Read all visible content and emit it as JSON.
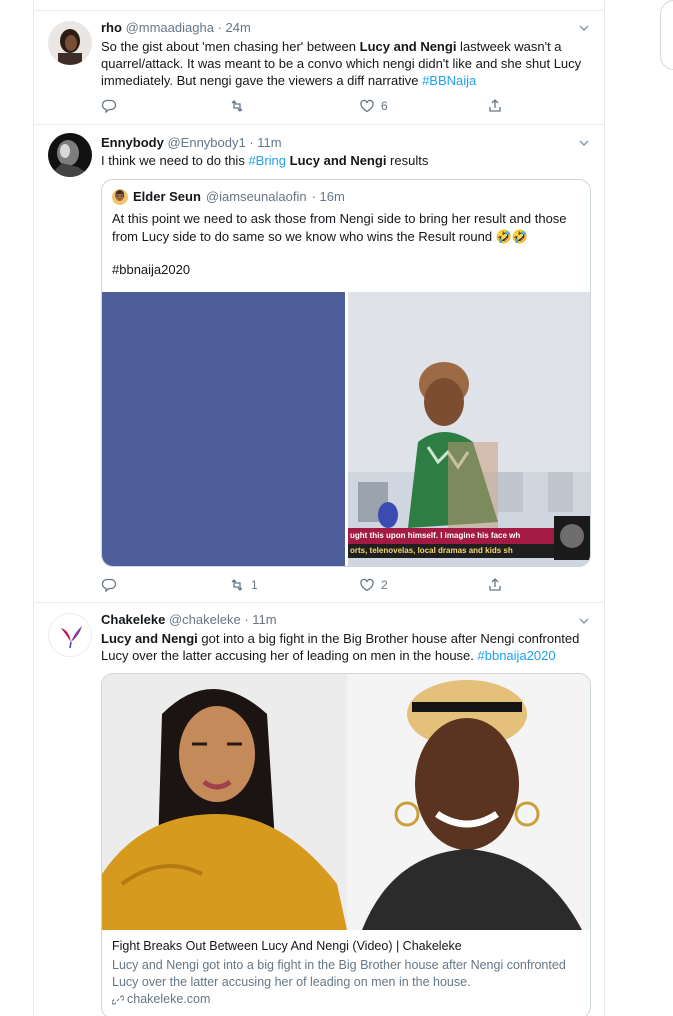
{
  "tweets": [
    {
      "name": "rho",
      "handle": "@mmaadiagha",
      "time": "· 24m",
      "text_parts": [
        "So the gist about 'men chasing her' between ",
        "Lucy and Nengi",
        " lastweek wasn't a quarrel/attack. It was meant to be a convo which nengi didn't like and she shut Lucy immediately. But nengi gave the viewers a diff narrative ",
        "#BBNaija"
      ],
      "reply_count": "",
      "retweet_count": "",
      "like_count": "6"
    },
    {
      "name": "Ennybody",
      "handle": "@Ennybody1",
      "time": "· 11m",
      "text_parts": [
        "I think we need to do this ",
        "#Bring",
        " ",
        "Lucy and Nengi",
        " results"
      ],
      "quote": {
        "name": "Elder Seun",
        "handle": "@iamseunalaofin",
        "time": "· 16m",
        "text": "At this point we need to ask those from Nengi side to bring her result and those from Lucy side to do same so we know who wins the Result round 🤣🤣",
        "hashtag": "#bbnaija2020",
        "caption_line1": "ught this upon himself. I imagine his face wh",
        "caption_line2": "orts, telenovelas, local dramas and kids sh"
      },
      "reply_count": "",
      "retweet_count": "1",
      "like_count": "2"
    },
    {
      "name": "Chakeleke",
      "handle": "@chakeleke",
      "time": "· 11m",
      "text_parts": [
        "Lucy and Nengi",
        " got into a big fight in the Big Brother house after Nengi confronted Lucy over the latter accusing her of leading on men in the house. ",
        "#bbnaija2020"
      ],
      "card": {
        "title": "Fight Breaks Out Between Lucy And Nengi (Video) | Chakeleke",
        "description": "Lucy and Nengi got into a big fight in the Big Brother house after Nengi confronted Lucy over the latter accusing her of leading on men in the house.",
        "domain": "chakeleke.com"
      }
    }
  ],
  "icons": {
    "reply": "reply-icon",
    "retweet": "retweet-icon",
    "like": "heart-icon",
    "share": "share-icon",
    "caret": "chevron-down-icon",
    "link": "link-icon"
  },
  "colors": {
    "link": "#1da1f2",
    "secondary": "#657786",
    "border": "#e6ecf0",
    "blue_panel": "#4e5e9b"
  }
}
